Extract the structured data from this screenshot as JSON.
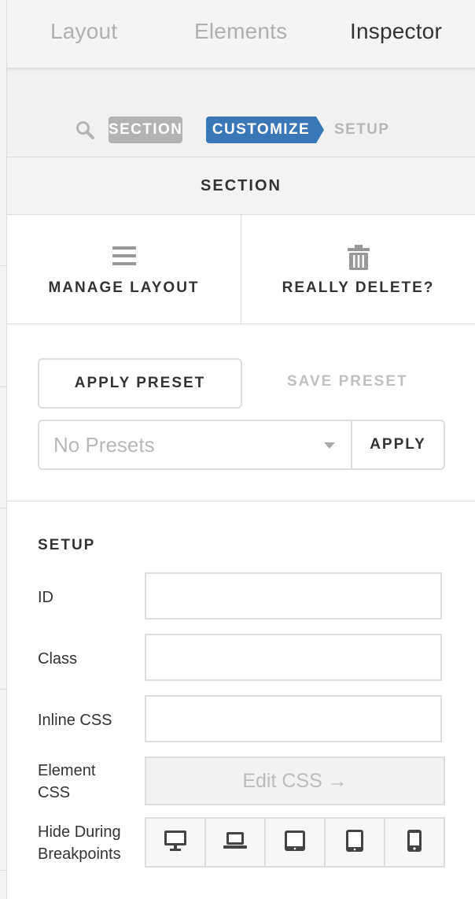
{
  "tabs": {
    "layout": "Layout",
    "elements": "Elements",
    "inspector": "Inspector",
    "active": "Inspector"
  },
  "breadcrumb": {
    "search_icon": "search-icon",
    "section": "SECTION",
    "customize": "CUSTOMIZE",
    "setup": "SETUP"
  },
  "header": {
    "title": "SECTION"
  },
  "actions": {
    "manage_layout": {
      "label": "MANAGE LAYOUT",
      "icon": "menu-icon"
    },
    "delete": {
      "label": "REALLY DELETE?",
      "icon": "trash-icon"
    }
  },
  "presets": {
    "apply_preset": "APPLY PRESET",
    "save_preset": "SAVE PRESET",
    "select_value": "No Presets",
    "apply": "APPLY"
  },
  "setup": {
    "title": "SETUP",
    "id_label": "ID",
    "id_value": "",
    "class_label": "Class",
    "class_value": "",
    "inline_css_label": "Inline CSS",
    "inline_css_value": "",
    "element_css_label_1": "Element",
    "element_css_label_2": "CSS",
    "edit_css_button": "Edit CSS →",
    "hide_label_1": "Hide During",
    "hide_label_2": "Breakpoints",
    "breakpoints": [
      "desktop-icon",
      "laptop-icon",
      "tablet-landscape-icon",
      "tablet-portrait-icon",
      "phone-icon"
    ]
  },
  "colors": {
    "accent": "#3a77b6",
    "muted": "#b3b3b3",
    "border": "#dddddd"
  }
}
